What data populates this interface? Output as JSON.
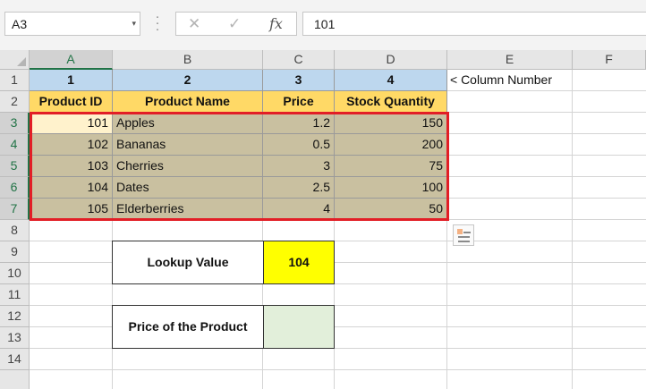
{
  "formula_bar": {
    "name_box": "A3",
    "name_box_dropdown": "▾",
    "cancel_glyph": "✕",
    "enter_glyph": "✓",
    "fx_glyph": "fx",
    "formula": "101"
  },
  "grid": {
    "columns": [
      "A",
      "B",
      "C",
      "D",
      "E",
      "F"
    ],
    "rows": [
      "1",
      "2",
      "3",
      "4",
      "5",
      "6",
      "7",
      "8",
      "9",
      "10",
      "11",
      "12",
      "13",
      "14"
    ]
  },
  "sheet": {
    "col_numbers": [
      "1",
      "2",
      "3",
      "4"
    ],
    "col_number_note": "< Column Number",
    "headers": [
      "Product ID",
      "Product Name",
      "Price",
      "Stock Quantity"
    ],
    "data": [
      [
        "101",
        "Apples",
        "1.2",
        "150"
      ],
      [
        "102",
        "Bananas",
        "0.5",
        "200"
      ],
      [
        "103",
        "Cherries",
        "3",
        "75"
      ],
      [
        "104",
        "Dates",
        "2.5",
        "100"
      ],
      [
        "105",
        "Elderberries",
        "4",
        "50"
      ]
    ],
    "lookup_label": "Lookup Value",
    "lookup_value": "104",
    "price_label": "Price of the Product",
    "price_value": ""
  },
  "colors": {
    "col_number_fill": "#bdd7ee",
    "header_fill": "#ffd966",
    "data_fill": "#c9c0a0",
    "lookup_fill": "#ffff00",
    "result_fill": "#e2efda",
    "highlight_border": "#e21e26"
  },
  "icons": {
    "quick_analysis": "quick-analysis-icon"
  }
}
